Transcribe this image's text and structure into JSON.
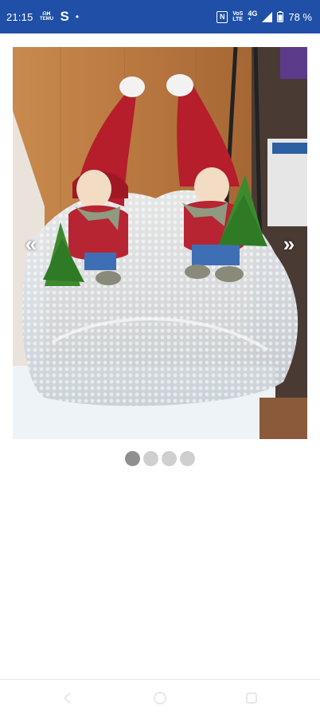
{
  "status_bar": {
    "time": "21:15",
    "temu_top": "ᗩᕼ",
    "temu_bottom": "TEMU",
    "app_letter": "S",
    "dot": "•",
    "nfc": "N",
    "volte_top": "VoS",
    "volte_bottom": "LTE",
    "network_top": "4G",
    "network_bottom": "+",
    "battery_percent": "78 %",
    "icons": [
      "temu-icon",
      "s-app-icon",
      "notification-dot",
      "nfc-icon",
      "volte-icon",
      "signal-icon",
      "battery-icon"
    ]
  },
  "gallery": {
    "image_description_icon": "photo",
    "prev_arrow": "«",
    "next_arrow": "»",
    "current_index": 1,
    "total_images": 4
  },
  "nav_bar": {
    "icons": [
      "back-icon",
      "home-icon",
      "recent-apps-icon"
    ]
  },
  "colors": {
    "status_bar_bg": "#1f4fa6",
    "dot_active": "#8f8f8f",
    "dot_inactive": "#cfcfcf"
  }
}
